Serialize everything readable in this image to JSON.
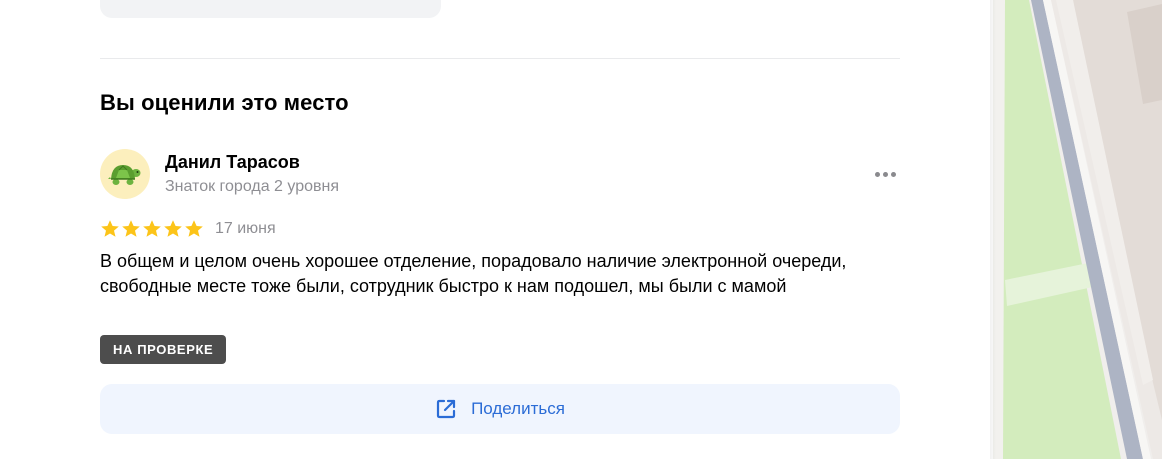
{
  "section": {
    "title": "Вы оценили это место"
  },
  "review": {
    "author": {
      "name": "Данил Тарасов",
      "level": "Знаток города 2 уровня",
      "avatar": "turtle-emoji"
    },
    "rating": {
      "value": 5,
      "max": 5
    },
    "date": "17 июня",
    "text": "В общем и целом очень хорошее отделение, порадовало наличие электронной очереди, свободные месте тоже были, сотрудник быстро к нам подошел, мы были с мамой",
    "status_badge": "НА ПРОВЕРКЕ",
    "more_icon": "more-dots-icon"
  },
  "share": {
    "label": "Поделиться",
    "icon": "share-external-icon"
  },
  "colors": {
    "star": "#fcc419",
    "accent": "#2b6cd6",
    "badge_bg": "#4d4d4d",
    "share_bg": "#f0f5fe",
    "muted_text": "#8e8e93"
  }
}
